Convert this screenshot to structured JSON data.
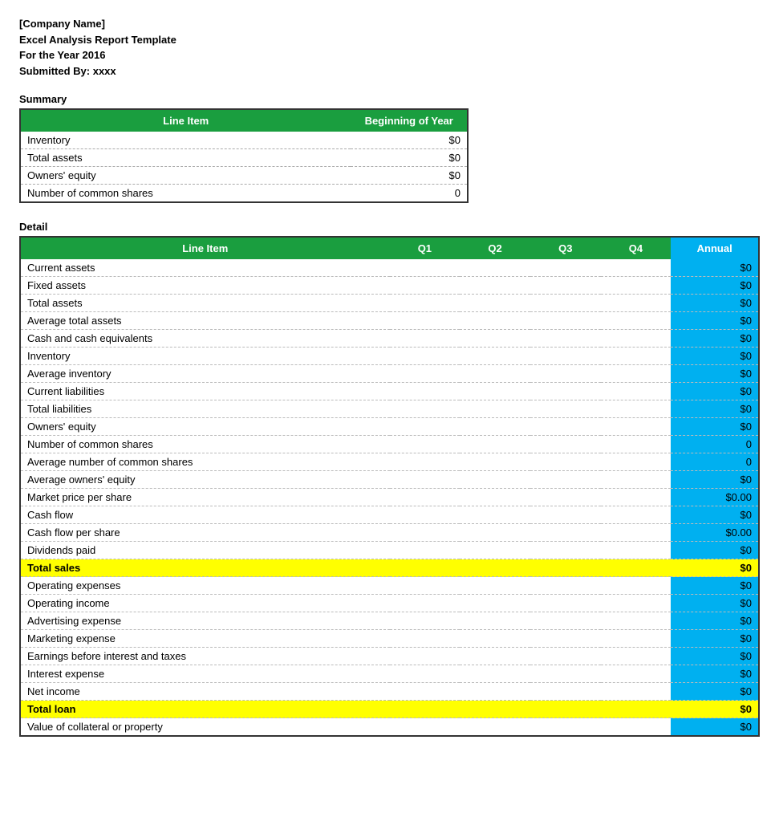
{
  "header": {
    "line1": "[Company Name]",
    "line2": "Excel Analysis Report Template",
    "line3": "For the Year 2016",
    "line4": "Submitted By:  xxxx"
  },
  "summary": {
    "label": "Summary",
    "columns": {
      "line_item": "Line Item",
      "beginning_of_year": "Beginning of Year"
    },
    "rows": [
      {
        "label": "Inventory",
        "value": "$0"
      },
      {
        "label": "Total assets",
        "value": "$0"
      },
      {
        "label": "Owners' equity",
        "value": "$0"
      },
      {
        "label": "Number of common shares",
        "value": "0"
      }
    ]
  },
  "detail": {
    "label": "Detail",
    "columns": {
      "line_item": "Line Item",
      "q1": "Q1",
      "q2": "Q2",
      "q3": "Q3",
      "q4": "Q4",
      "annual": "Annual"
    },
    "rows": [
      {
        "label": "Current assets",
        "q1": "",
        "q2": "",
        "q3": "",
        "q4": "",
        "annual": "$0",
        "type": "normal"
      },
      {
        "label": "Fixed assets",
        "q1": "",
        "q2": "",
        "q3": "",
        "q4": "",
        "annual": "$0",
        "type": "normal"
      },
      {
        "label": "Total assets",
        "q1": "",
        "q2": "",
        "q3": "",
        "q4": "",
        "annual": "$0",
        "type": "normal"
      },
      {
        "label": "Average total assets",
        "q1": "",
        "q2": "",
        "q3": "",
        "q4": "",
        "annual": "$0",
        "type": "normal"
      },
      {
        "label": "Cash and cash equivalents",
        "q1": "",
        "q2": "",
        "q3": "",
        "q4": "",
        "annual": "$0",
        "type": "normal"
      },
      {
        "label": "Inventory",
        "q1": "",
        "q2": "",
        "q3": "",
        "q4": "",
        "annual": "$0",
        "type": "normal"
      },
      {
        "label": "Average inventory",
        "q1": "",
        "q2": "",
        "q3": "",
        "q4": "",
        "annual": "$0",
        "type": "normal"
      },
      {
        "label": "Current liabilities",
        "q1": "",
        "q2": "",
        "q3": "",
        "q4": "",
        "annual": "$0",
        "type": "normal"
      },
      {
        "label": "Total liabilities",
        "q1": "",
        "q2": "",
        "q3": "",
        "q4": "",
        "annual": "$0",
        "type": "normal"
      },
      {
        "label": "Owners' equity",
        "q1": "",
        "q2": "",
        "q3": "",
        "q4": "",
        "annual": "$0",
        "type": "normal"
      },
      {
        "label": "Number of common shares",
        "q1": "",
        "q2": "",
        "q3": "",
        "q4": "",
        "annual": "0",
        "type": "normal"
      },
      {
        "label": "Average number of common shares",
        "q1": "",
        "q2": "",
        "q3": "",
        "q4": "",
        "annual": "0",
        "type": "normal"
      },
      {
        "label": "Average owners' equity",
        "q1": "",
        "q2": "",
        "q3": "",
        "q4": "",
        "annual": "$0",
        "type": "normal"
      },
      {
        "label": "Market price per share",
        "q1": "",
        "q2": "",
        "q3": "",
        "q4": "",
        "annual": "$0.00",
        "type": "normal"
      },
      {
        "label": "Cash flow",
        "q1": "",
        "q2": "",
        "q3": "",
        "q4": "",
        "annual": "$0",
        "type": "normal"
      },
      {
        "label": "Cash flow per share",
        "q1": "",
        "q2": "",
        "q3": "",
        "q4": "",
        "annual": "$0.00",
        "type": "normal"
      },
      {
        "label": "Dividends paid",
        "q1": "",
        "q2": "",
        "q3": "",
        "q4": "",
        "annual": "$0",
        "type": "normal"
      },
      {
        "label": "Total sales",
        "q1": "",
        "q2": "",
        "q3": "",
        "q4": "",
        "annual": "$0",
        "type": "yellow"
      },
      {
        "label": "Operating expenses",
        "q1": "",
        "q2": "",
        "q3": "",
        "q4": "",
        "annual": "$0",
        "type": "normal"
      },
      {
        "label": "Operating income",
        "q1": "",
        "q2": "",
        "q3": "",
        "q4": "",
        "annual": "$0",
        "type": "normal"
      },
      {
        "label": "Advertising expense",
        "q1": "",
        "q2": "",
        "q3": "",
        "q4": "",
        "annual": "$0",
        "type": "normal"
      },
      {
        "label": "Marketing expense",
        "q1": "",
        "q2": "",
        "q3": "",
        "q4": "",
        "annual": "$0",
        "type": "normal"
      },
      {
        "label": "Earnings before interest and taxes",
        "q1": "",
        "q2": "",
        "q3": "",
        "q4": "",
        "annual": "$0",
        "type": "normal"
      },
      {
        "label": "Interest expense",
        "q1": "",
        "q2": "",
        "q3": "",
        "q4": "",
        "annual": "$0",
        "type": "normal"
      },
      {
        "label": "Net income",
        "q1": "",
        "q2": "",
        "q3": "",
        "q4": "",
        "annual": "$0",
        "type": "normal"
      },
      {
        "label": "Total loan",
        "q1": "",
        "q2": "",
        "q3": "",
        "q4": "",
        "annual": "$0",
        "type": "yellow"
      },
      {
        "label": "Value of collateral or property",
        "q1": "",
        "q2": "",
        "q3": "",
        "q4": "",
        "annual": "$0",
        "type": "normal"
      }
    ]
  }
}
